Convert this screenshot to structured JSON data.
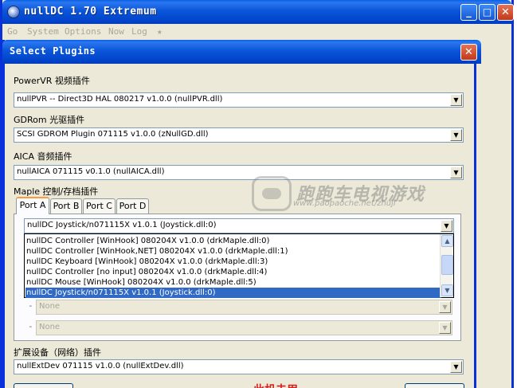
{
  "app": {
    "title": "nullDC 1.70 Extremum",
    "minimize": "_",
    "maximize": "□",
    "close": "✕"
  },
  "menu": [
    "Go",
    "System",
    "Options",
    "Now",
    "Log",
    "★"
  ],
  "dialog": {
    "title": "Select Plugins",
    "close": "✕",
    "pvr": {
      "label": "PowerVR 视频插件",
      "value": "nullPVR -- Direct3D HAL 080217 v1.0.0 (nullPVR.dll)"
    },
    "gdrom": {
      "label": "GDRom 光驱插件",
      "value": "SCSI GDROM Plugin 071115 v1.0.0 (zNullGD.dll)"
    },
    "aica": {
      "label": "AICA 音频插件",
      "value": "nullAICA 071115 v0.1.0 (nullAICA.dll)"
    },
    "maple": {
      "label": "Maple 控制/存档插件",
      "tabs": [
        "Port A",
        "Port B",
        "Port C",
        "Port D"
      ],
      "selected_value": "nullDC Joystick/n071115X v1.0.1 (Joystick.dll:0)",
      "options": [
        "nullDC Controller [WinHook] 080204X v1.0.0 (drkMaple.dll:0)",
        "nullDC Controller [WinHook,NET] 080204X v1.0.0 (drkMaple.dll:1)",
        "nullDC Keyboard [WinHook] 080204X v1.0.0 (drkMaple.dll:3)",
        "nullDC Controller [no input] 080204X v1.0.0 (drkMaple.dll:4)",
        "nullDC Mouse [WinHook] 080204X v1.0.0 (drkMaple.dll:5)",
        "nullDC Joystick/n071115X v1.0.1 (Joystick.dll:0)"
      ],
      "sub_slots": [
        "None",
        "None"
      ]
    },
    "extdev": {
      "label": "扩展设备（网络）插件",
      "value": "nullExtDev 071115 v1.0.0 (nullExtDev.dll)"
    }
  },
  "watermark": {
    "site_cn": "跑跑车电视游戏",
    "site_url": "www.paopaoche.net/zhuji"
  },
  "bottom_note": "此机未用"
}
